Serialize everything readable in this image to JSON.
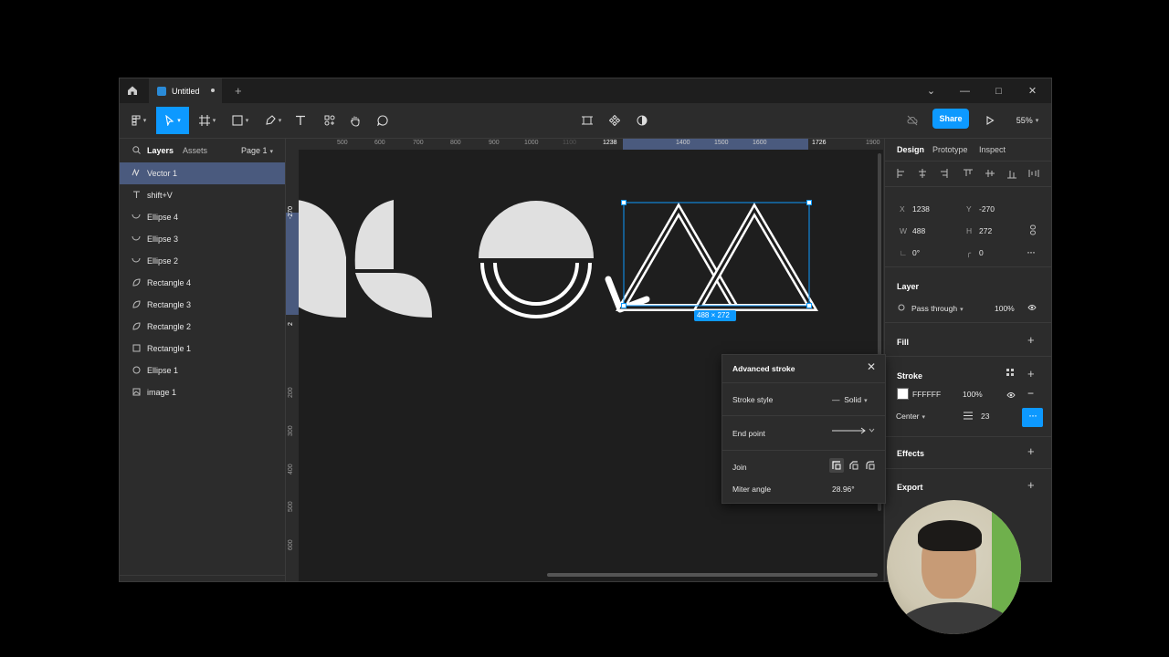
{
  "titlebar": {
    "home_icon": "home-icon",
    "tab_title": "Untitled",
    "new_tab": "+",
    "controls": [
      "⌄",
      "—",
      "□",
      "✕"
    ]
  },
  "toolbar": {
    "share_label": "Share",
    "zoom": "55%"
  },
  "left_panel": {
    "tabs": [
      "Layers",
      "Assets"
    ],
    "page": "Page 1",
    "layers": [
      {
        "name": "Vector 1",
        "icon": "vector-icon",
        "selected": true
      },
      {
        "name": "shift+V",
        "icon": "text-icon"
      },
      {
        "name": "Ellipse 4",
        "icon": "arc-icon"
      },
      {
        "name": "Ellipse 3",
        "icon": "arc-icon"
      },
      {
        "name": "Ellipse 2",
        "icon": "arc-icon"
      },
      {
        "name": "Rectangle 4",
        "icon": "leaf-icon"
      },
      {
        "name": "Rectangle 3",
        "icon": "leaf-icon"
      },
      {
        "name": "Rectangle 2",
        "icon": "leaf-icon"
      },
      {
        "name": "Rectangle 1",
        "icon": "rectangle-icon"
      },
      {
        "name": "Ellipse 1",
        "icon": "ellipse-icon"
      },
      {
        "name": "image 1",
        "icon": "image-icon"
      }
    ]
  },
  "rulers": {
    "top": [
      "500",
      "600",
      "700",
      "800",
      "900",
      "1000",
      "1100",
      "1238",
      "1400",
      "1500",
      "1600",
      "1726",
      "1900"
    ],
    "left": [
      "-270",
      "2",
      "200",
      "300",
      "400",
      "500",
      "600"
    ]
  },
  "canvas": {
    "selection_label": "488 × 272"
  },
  "right_panel": {
    "tabs": [
      "Design",
      "Prototype",
      "Inspect"
    ],
    "x_label": "X",
    "x": "1238",
    "y_label": "Y",
    "y": "-270",
    "w_label": "W",
    "w": "488",
    "h_label": "H",
    "h": "272",
    "rotation": "0°",
    "radius": "0",
    "layer_title": "Layer",
    "blend": "Pass through",
    "opacity": "100%",
    "fill_title": "Fill",
    "stroke_title": "Stroke",
    "stroke_color": "FFFFFF",
    "stroke_opacity": "100%",
    "stroke_align": "Center",
    "stroke_weight": "23",
    "effects_title": "Effects",
    "export_title": "Export"
  },
  "advanced_stroke": {
    "title": "Advanced stroke",
    "stroke_style_label": "Stroke style",
    "stroke_style": "Solid",
    "end_point_label": "End point",
    "join_label": "Join",
    "miter_label": "Miter angle",
    "miter_value": "28.96°"
  },
  "colors": {
    "accent": "#0d99ff",
    "selection_row": "#4a5a7e",
    "canvas_bg": "#1e1e1e",
    "panel_bg": "#2c2c2c",
    "shape_fill": "#e0e0e0"
  }
}
